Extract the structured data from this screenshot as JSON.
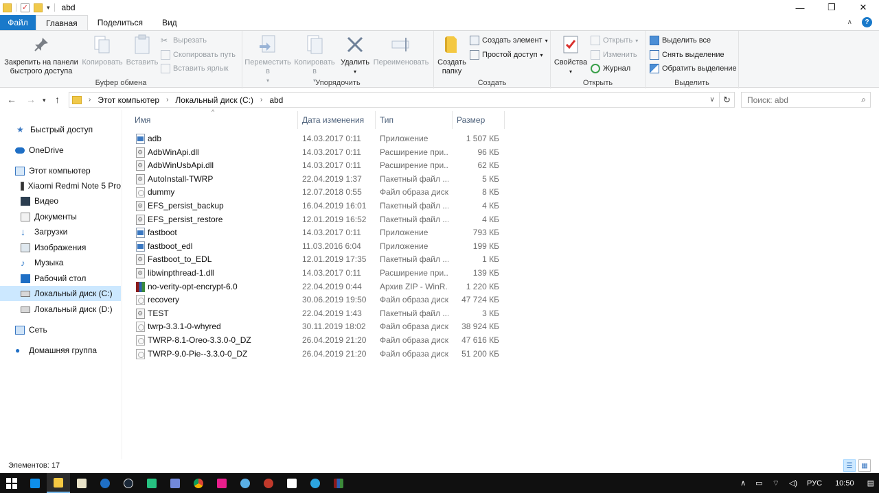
{
  "window": {
    "title": "abd",
    "controls": {
      "minimize": "—",
      "maximize": "❐",
      "close": "✕"
    }
  },
  "ribbon_tabs": [
    "Файл",
    "Главная",
    "Поделиться",
    "Вид"
  ],
  "ribbon": {
    "clipboard": {
      "label": "Буфер обмена",
      "pin": "Закрепить на панели быстрого доступа",
      "copy": "Копировать",
      "paste": "Вставить",
      "cut": "Вырезать",
      "copy_path": "Скопировать путь",
      "paste_shortcut": "Вставить ярлык"
    },
    "organize": {
      "label": "Упорядочить",
      "move_to": "Переместить в",
      "copy_to": "Копировать в",
      "delete": "Удалить",
      "rename": "Переименовать"
    },
    "create": {
      "label": "Создать",
      "new_folder": "Создать папку",
      "new_item": "Создать элемент",
      "easy_access": "Простой доступ"
    },
    "open": {
      "label": "Открыть",
      "properties": "Свойства",
      "open": "Открыть",
      "edit": "Изменить",
      "history": "Журнал"
    },
    "select": {
      "label": "Выделить",
      "select_all": "Выделить все",
      "select_none": "Снять выделение",
      "invert": "Обратить выделение"
    }
  },
  "address": {
    "crumbs": [
      "Этот компьютер",
      "Локальный диск (C:)",
      "abd"
    ],
    "search_placeholder": "Поиск: abd"
  },
  "sidebar": {
    "items": [
      {
        "label": "Быстрый доступ",
        "icon": "star-icon"
      },
      {
        "label": "OneDrive",
        "icon": "cloud-icon"
      },
      {
        "label": "Этот компьютер",
        "icon": "computer-icon"
      },
      {
        "label": "Xiaomi Redmi Note 5 Pro",
        "icon": "phone-icon"
      },
      {
        "label": "Видео",
        "icon": "video-icon"
      },
      {
        "label": "Документы",
        "icon": "documents-icon"
      },
      {
        "label": "Загрузки",
        "icon": "downloads-icon"
      },
      {
        "label": "Изображения",
        "icon": "pictures-icon"
      },
      {
        "label": "Музыка",
        "icon": "music-icon"
      },
      {
        "label": "Рабочий стол",
        "icon": "desktop-icon"
      },
      {
        "label": "Локальный диск (C:)",
        "icon": "drive-icon"
      },
      {
        "label": "Локальный диск  (D:)",
        "icon": "drive-icon"
      },
      {
        "label": "Сеть",
        "icon": "network-icon"
      },
      {
        "label": "Домашняя группа",
        "icon": "homegroup-icon"
      }
    ]
  },
  "columns": {
    "name": "Имя",
    "date": "Дата изменения",
    "type": "Тип",
    "size": "Размер"
  },
  "files": [
    {
      "name": "adb",
      "date": "14.03.2017 0:11",
      "type": "Приложение",
      "size": "1 507 КБ",
      "kind": "app"
    },
    {
      "name": "AdbWinApi.dll",
      "date": "14.03.2017 0:11",
      "type": "Расширение при...",
      "size": "96 КБ",
      "kind": "dll"
    },
    {
      "name": "AdbWinUsbApi.dll",
      "date": "14.03.2017 0:11",
      "type": "Расширение при...",
      "size": "62 КБ",
      "kind": "dll"
    },
    {
      "name": "AutoInstall-TWRP",
      "date": "22.04.2019 1:37",
      "type": "Пакетный файл ...",
      "size": "5 КБ",
      "kind": "bat"
    },
    {
      "name": "dummy",
      "date": "12.07.2018 0:55",
      "type": "Файл образа диска",
      "size": "8 КБ",
      "kind": "img"
    },
    {
      "name": "EFS_persist_backup",
      "date": "16.04.2019 16:01",
      "type": "Пакетный файл ...",
      "size": "4 КБ",
      "kind": "bat"
    },
    {
      "name": "EFS_persist_restore",
      "date": "12.01.2019 16:52",
      "type": "Пакетный файл ...",
      "size": "4 КБ",
      "kind": "bat"
    },
    {
      "name": "fastboot",
      "date": "14.03.2017 0:11",
      "type": "Приложение",
      "size": "793 КБ",
      "kind": "app"
    },
    {
      "name": "fastboot_edl",
      "date": "11.03.2016 6:04",
      "type": "Приложение",
      "size": "199 КБ",
      "kind": "app"
    },
    {
      "name": "Fastboot_to_EDL",
      "date": "12.01.2019 17:35",
      "type": "Пакетный файл ...",
      "size": "1 КБ",
      "kind": "bat"
    },
    {
      "name": "libwinpthread-1.dll",
      "date": "14.03.2017 0:11",
      "type": "Расширение при...",
      "size": "139 КБ",
      "kind": "dll"
    },
    {
      "name": "no-verity-opt-encrypt-6.0",
      "date": "22.04.2019 0:44",
      "type": "Архив ZIP - WinR...",
      "size": "1 220 КБ",
      "kind": "zip"
    },
    {
      "name": "recovery",
      "date": "30.06.2019 19:50",
      "type": "Файл образа диска",
      "size": "47 724 КБ",
      "kind": "img"
    },
    {
      "name": "TEST",
      "date": "22.04.2019 1:43",
      "type": "Пакетный файл ...",
      "size": "3 КБ",
      "kind": "bat"
    },
    {
      "name": "twrp-3.3.1-0-whyred",
      "date": "30.11.2019 18:02",
      "type": "Файл образа диска",
      "size": "38 924 КБ",
      "kind": "img"
    },
    {
      "name": "TWRP-8.1-Oreo-3.3.0-0_DZ",
      "date": "26.04.2019 21:20",
      "type": "Файл образа диска",
      "size": "47 616 КБ",
      "kind": "img"
    },
    {
      "name": "TWRP-9.0-Pie--3.3.0-0_DZ",
      "date": "26.04.2019 21:20",
      "type": "Файл образа диска",
      "size": "51 200 КБ",
      "kind": "img"
    }
  ],
  "status": {
    "items_count": "Элементов: 17"
  },
  "taskbar": {
    "icons": [
      "start-icon",
      "teamviewer-icon",
      "file-explorer-icon",
      "notepad-icon",
      "edge-icon",
      "steam-icon",
      "vpn-icon",
      "discord-icon",
      "chrome-icon",
      "app-icon",
      "network-app-icon",
      "game-icon",
      "store-icon",
      "telegram-icon",
      "winrar-icon"
    ],
    "language": "РУС",
    "time": "10:50"
  },
  "colors": {
    "accent": "#1979ca",
    "selection": "#cce8ff",
    "ribbon_bg": "#f5f6f7",
    "taskbar_bg": "#101010"
  }
}
